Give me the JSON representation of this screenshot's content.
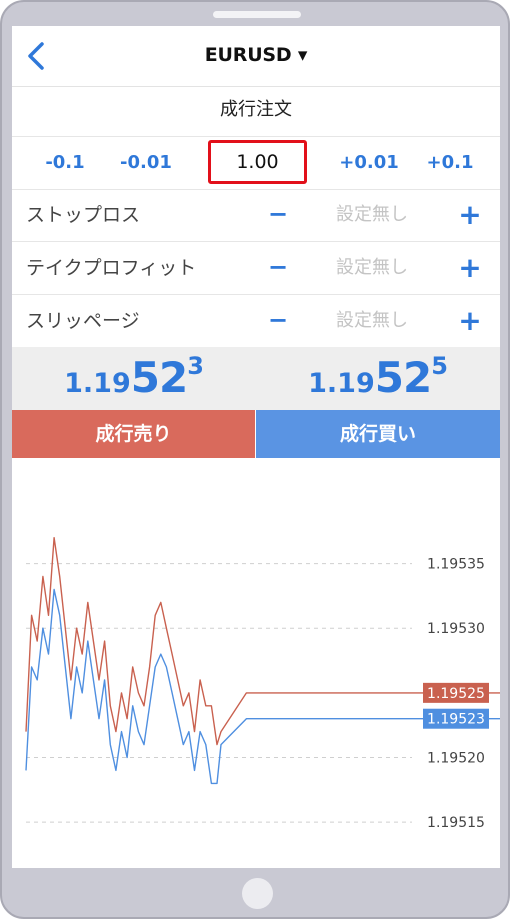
{
  "header": {
    "title": "EURUSD ▾"
  },
  "order_type": "成行注文",
  "lot": {
    "decrements": [
      "-0.1",
      "-0.01"
    ],
    "value": "1.00",
    "increments": [
      "+0.01",
      "+0.1"
    ]
  },
  "settings": [
    {
      "label": "ストップロス",
      "minus": "−",
      "value": "設定無し",
      "plus": "+"
    },
    {
      "label": "テイクプロフィット",
      "minus": "−",
      "value": "設定無し",
      "plus": "+"
    },
    {
      "label": "スリッページ",
      "minus": "−",
      "value": "設定無し",
      "plus": "+"
    }
  ],
  "quotes": {
    "bid": {
      "small": "1.19",
      "big": "52",
      "sup": "3"
    },
    "ask": {
      "small": "1.19",
      "big": "52",
      "sup": "5"
    }
  },
  "buttons": {
    "sell": "成行売り",
    "buy": "成行買い"
  },
  "colors": {
    "accent": "#2f78d9",
    "sell": "#d96a5c",
    "buy": "#5a94e3",
    "sell_line": "#c9614f",
    "buy_line": "#4f8fe0",
    "highlight": "#e2101a"
  },
  "chart_data": {
    "type": "line",
    "y_ticks": [
      "1.19535",
      "1.19530",
      "1.19520",
      "1.19515"
    ],
    "ylim": [
      1.19513,
      1.19541
    ],
    "grid": true,
    "series": [
      {
        "values": [
          1.19522,
          1.19531,
          1.19529,
          1.19534,
          1.19531,
          1.19537,
          1.19534,
          1.1953,
          1.19526,
          1.1953,
          1.19528,
          1.19532,
          1.19529,
          1.19526,
          1.19529,
          1.19524,
          1.19522,
          1.19525,
          1.19523,
          1.19527,
          1.19525,
          1.19524,
          1.19527,
          1.19531,
          1.19532,
          1.1953,
          1.19528,
          1.19526,
          1.19524,
          1.19525,
          1.19522,
          1.19526,
          1.19524,
          1.19524,
          1.19521,
          1.19522,
          1.19525,
          1.19525,
          1.19525,
          1.19525,
          1.19525,
          1.19525,
          1.19525,
          1.19525,
          1.19525,
          1.19525,
          1.19525
        ]
      },
      {
        "values": [
          1.19519,
          1.19527,
          1.19526,
          1.1953,
          1.19528,
          1.19533,
          1.19531,
          1.19527,
          1.19523,
          1.19527,
          1.19525,
          1.19529,
          1.19526,
          1.19523,
          1.19526,
          1.19521,
          1.19519,
          1.19522,
          1.1952,
          1.19524,
          1.19522,
          1.19521,
          1.19524,
          1.19527,
          1.19528,
          1.19527,
          1.19525,
          1.19523,
          1.19521,
          1.19522,
          1.19519,
          1.19522,
          1.19521,
          1.19518,
          1.19518,
          1.19521,
          1.19523,
          1.19523,
          1.19523,
          1.19523,
          1.19523,
          1.19523,
          1.19523,
          1.19523,
          1.19523,
          1.19523,
          1.19523
        ]
      }
    ],
    "price_tags": [
      "1.19525",
      "1.19523"
    ]
  }
}
